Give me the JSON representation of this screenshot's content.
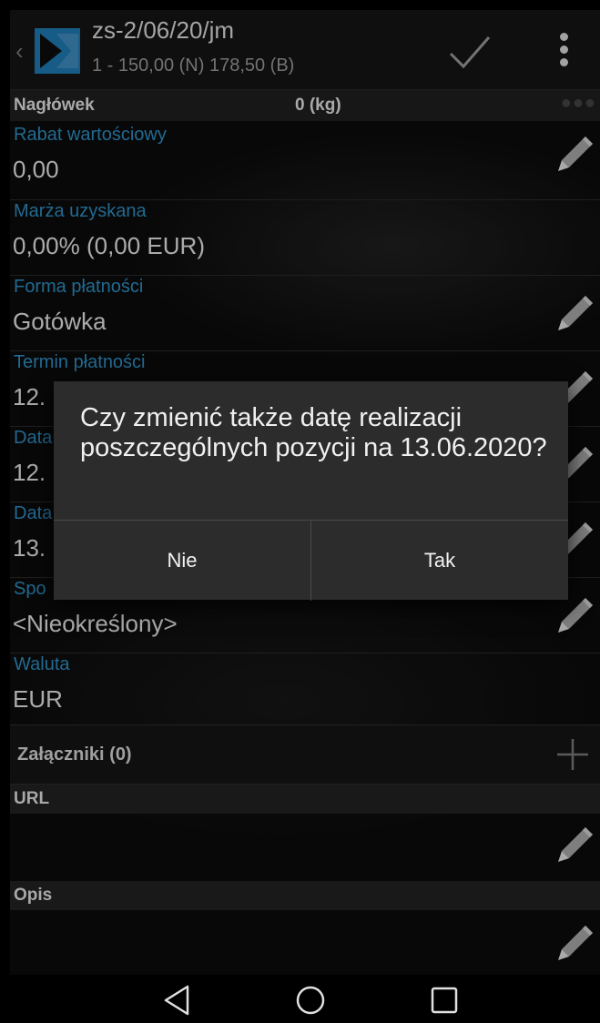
{
  "header": {
    "title": "zs-2/06/20/jm",
    "subtitle": "1 - 150,00 (N) 178,50 (B)"
  },
  "section": {
    "label": "Nagłówek",
    "weight": "0 (kg)"
  },
  "fields": [
    {
      "label": "Rabat wartościowy",
      "value": "0,00"
    },
    {
      "label": "Marża uzyskana",
      "value": "0,00% (0,00 EUR)"
    },
    {
      "label": "Forma płatności",
      "value": "Gotówka"
    },
    {
      "label": "Termin płatności",
      "value": "12."
    },
    {
      "label": "Data",
      "value": "12."
    },
    {
      "label": "Data",
      "value": "13."
    },
    {
      "label": "Spo",
      "value": "<Nieokreślony>"
    },
    {
      "label": "Waluta",
      "value": "EUR"
    }
  ],
  "attachments": {
    "label": "Załączniki (0)"
  },
  "url_section": {
    "label": "URL"
  },
  "description_section": {
    "label": "Opis"
  },
  "dialog": {
    "message": "Czy zmienić także datę realizacji poszczególnych pozycji na 13.06.2020?",
    "no_label": "Nie",
    "yes_label": "Tak"
  },
  "colors": {
    "label_blue": "#2e8ec2",
    "logo_blue": "#1f7ab5",
    "dialog_bg": "#2c2c2c"
  },
  "icons": [
    "back-chevron-icon",
    "app-logo-icon",
    "check-icon",
    "overflow-menu-icon",
    "pencil-icon",
    "plus-icon",
    "nav-back-icon",
    "nav-home-icon",
    "nav-recents-icon"
  ]
}
